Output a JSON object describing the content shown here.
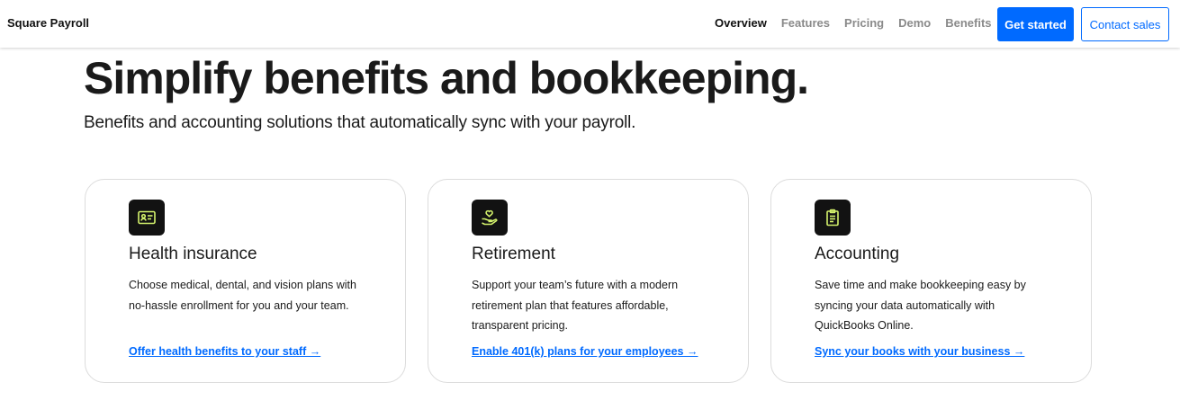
{
  "header": {
    "brand": "Square Payroll",
    "nav": [
      {
        "label": "Overview",
        "active": true
      },
      {
        "label": "Features",
        "active": false
      },
      {
        "label": "Pricing",
        "active": false
      },
      {
        "label": "Demo",
        "active": false
      },
      {
        "label": "Benefits",
        "active": false
      }
    ],
    "get_started": "Get started",
    "contact_sales": "Contact sales"
  },
  "hero": {
    "title": "Simplify benefits and bookkeeping.",
    "subtitle": "Benefits and accounting solutions that automatically sync with your payroll."
  },
  "cards": [
    {
      "icon": "id-card-icon",
      "title": "Health insurance",
      "description": "Choose medical, dental, and vision plans with no-hassle enrollment for you and your team.",
      "link": "Offer health benefits to your staff →"
    },
    {
      "icon": "hand-heart-icon",
      "title": "Retirement",
      "description": "Support your team’s future with a modern retirement plan that features affordable, transparent pricing.",
      "link": "Enable 401(k) plans for your employees →"
    },
    {
      "icon": "clipboard-icon",
      "title": "Accounting",
      "description": "Save time and make bookkeeping easy by syncing your data automatically with QuickBooks Online.",
      "link": "Sync your books with your business →"
    }
  ],
  "colors": {
    "accent": "#006aff",
    "icon_bg": "#121212",
    "icon_fg": "#d4f26c"
  }
}
